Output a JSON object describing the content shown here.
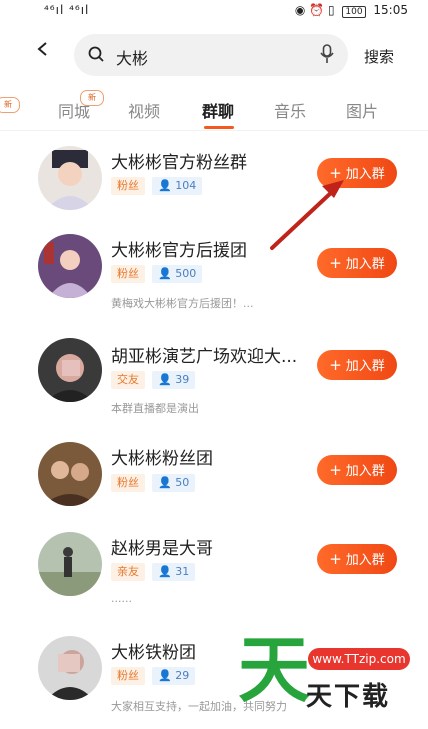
{
  "status_bar": {
    "signal_left": "⁴⁶ıl ⁴⁶ıl",
    "battery": "100",
    "time": "15:05"
  },
  "search": {
    "query": "大彬",
    "button_label": "搜索"
  },
  "tabs": [
    {
      "label": "同城",
      "badge": "新"
    },
    {
      "label": "视频"
    },
    {
      "label": "群聊"
    },
    {
      "label": "音乐"
    },
    {
      "label": "图片"
    }
  ],
  "tab_partial_badge": "新",
  "join_label": "加入群",
  "groups": [
    {
      "name": "大彬彬官方粉丝群",
      "tag": "粉丝",
      "members": "104",
      "description": ""
    },
    {
      "name": "大彬彬官方后援团",
      "tag": "粉丝",
      "members": "500",
      "description": "黄梅戏大彬彬官方后援团！..."
    },
    {
      "name": "胡亚彬演艺广场欢迎大...",
      "tag": "交友",
      "members": "39",
      "description": "本群直播都是演出"
    },
    {
      "name": "大彬彬粉丝团",
      "tag": "粉丝",
      "members": "50",
      "description": ""
    },
    {
      "name": "赵彬男是大哥",
      "tag": "亲友",
      "members": "31",
      "description": "......"
    },
    {
      "name": "大彬铁粉团",
      "tag": "粉丝",
      "members": "29",
      "description": "大家相互支持，一起加油，共同努力"
    }
  ],
  "watermark": {
    "big_char": "天",
    "url": "www.TTzip.com",
    "site_name": "天下载"
  },
  "colors": {
    "accent": "#f35a1f",
    "tag_orange": "#e6782c",
    "count_blue": "#4a7fc0",
    "watermark_green": "#27a53c"
  }
}
